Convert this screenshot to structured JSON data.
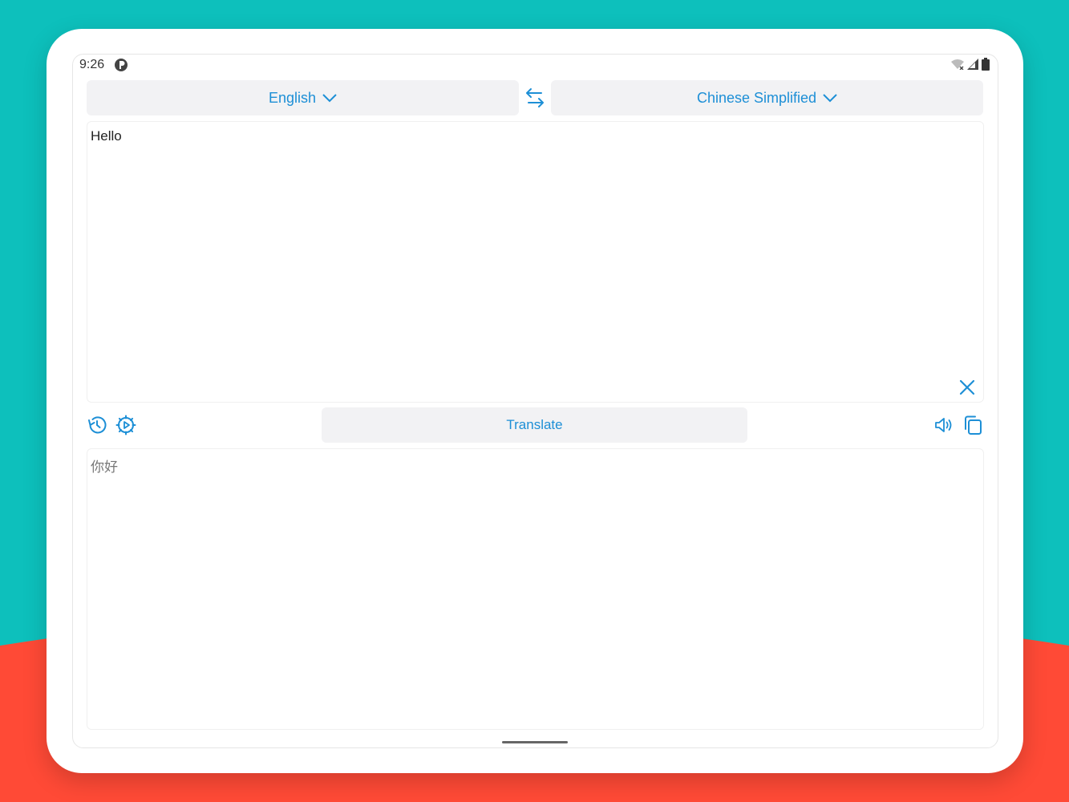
{
  "status_bar": {
    "time": "9:26",
    "icons": [
      "app-status-icon",
      "wifi-icon",
      "signal-icon",
      "battery-icon"
    ]
  },
  "language_bar": {
    "source_language": "English",
    "target_language": "Chinese Simplified"
  },
  "source": {
    "text": "Hello"
  },
  "toolbar": {
    "translate_label": "Translate"
  },
  "output": {
    "text": "你好"
  },
  "colors": {
    "accent": "#1d8fd6",
    "background_teal": "#0dc0bc",
    "background_red": "#ff4a36",
    "button_bg": "#f2f2f4"
  }
}
